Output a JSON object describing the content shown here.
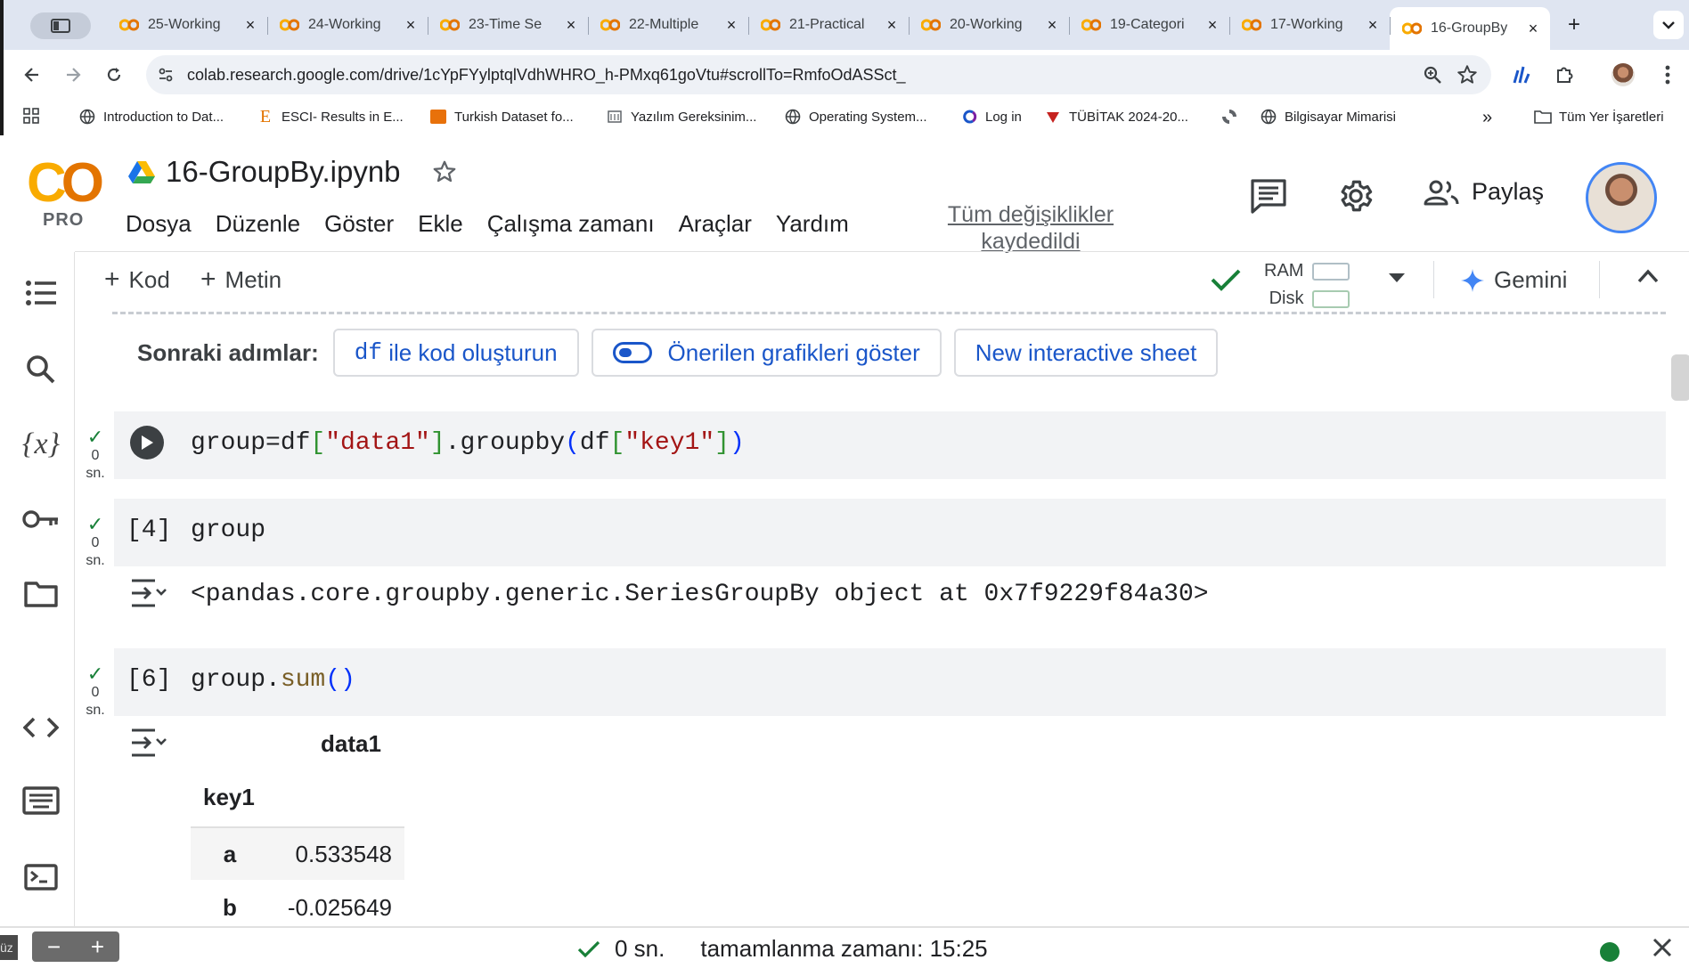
{
  "tabs": [
    {
      "title": "25-Working",
      "close": "×"
    },
    {
      "title": "24-Working",
      "close": "×"
    },
    {
      "title": "23-Time Se",
      "close": "×"
    },
    {
      "title": "22-Multiple",
      "close": "×"
    },
    {
      "title": "21-Practical",
      "close": "×"
    },
    {
      "title": "20-Working",
      "close": "×"
    },
    {
      "title": "19-Categori",
      "close": "×"
    },
    {
      "title": "17-Working",
      "close": "×"
    },
    {
      "title": "16-GroupBy",
      "close": "×"
    }
  ],
  "new_tab": "+",
  "address_bar": {
    "url": "colab.research.google.com/drive/1cYpFYylptqlVdhWHRO_h-PMxq61goVtu#scrollTo=RmfoOdASSct_"
  },
  "bookmarks": [
    {
      "label": "Introduction to Dat..."
    },
    {
      "label": "ESCI- Results in E..."
    },
    {
      "label": "Turkish Dataset fo..."
    },
    {
      "label": "Yazılım Gereksinim..."
    },
    {
      "label": "Operating System..."
    },
    {
      "label": "Log in"
    },
    {
      "label": "TÜBİTAK 2024-20..."
    },
    {
      "label": ""
    },
    {
      "label": "Bilgisayar Mimarisi"
    }
  ],
  "bookmarks_more": "»",
  "bookmarks_folder": "Tüm Yer İşaretleri",
  "colab": {
    "logo_text": "PRO",
    "notebook_title": "16-GroupBy.ipynb",
    "menu": [
      "Dosya",
      "Düzenle",
      "Göster",
      "Ekle",
      "Çalışma zamanı",
      "Araçlar",
      "Yardım"
    ],
    "saved_status": "Tüm değişiklikler kaydedildi",
    "share_label": "Paylaş"
  },
  "nb_toolbar": {
    "add_code": "Kod",
    "add_text": "Metin",
    "ram_label": "RAM",
    "disk_label": "Disk",
    "gemini_label": "Gemini"
  },
  "next_steps": {
    "label": "Sonraki adımlar:",
    "chip1_mono": "df",
    "chip1_text": "ile kod oluşturun",
    "chip2": "Önerilen grafikleri göster",
    "chip3": "New interactive sheet"
  },
  "cells": [
    {
      "exec": "",
      "status_time": "0",
      "status_unit": "sn.",
      "code": "group=df[\"data1\"].groupby(df[\"key1\"])"
    },
    {
      "exec": "[4]",
      "status_time": "0",
      "status_unit": "sn.",
      "code": "group",
      "output": "<pandas.core.groupby.generic.SeriesGroupBy object at 0x7f9229f84a30>"
    },
    {
      "exec": "[6]",
      "status_time": "0",
      "status_unit": "sn.",
      "code": "group.sum()"
    }
  ],
  "dataframe": {
    "column": "data1",
    "index_name": "key1",
    "rows": [
      {
        "key": "a",
        "value": "0.533548"
      },
      {
        "key": "b",
        "value": "-0.025649"
      }
    ]
  },
  "statusbar": {
    "left_label": "üz",
    "zoom_minus": "−",
    "zoom_plus": "+",
    "duration": "0 sn.",
    "completed": "tamamlanma zamanı: 15:25",
    "connected_color": "#188038"
  },
  "colors": {
    "accent": "#1a56c9",
    "logo_yellow": "#f9ab00",
    "logo_orange": "#e37400",
    "success": "#188038"
  }
}
